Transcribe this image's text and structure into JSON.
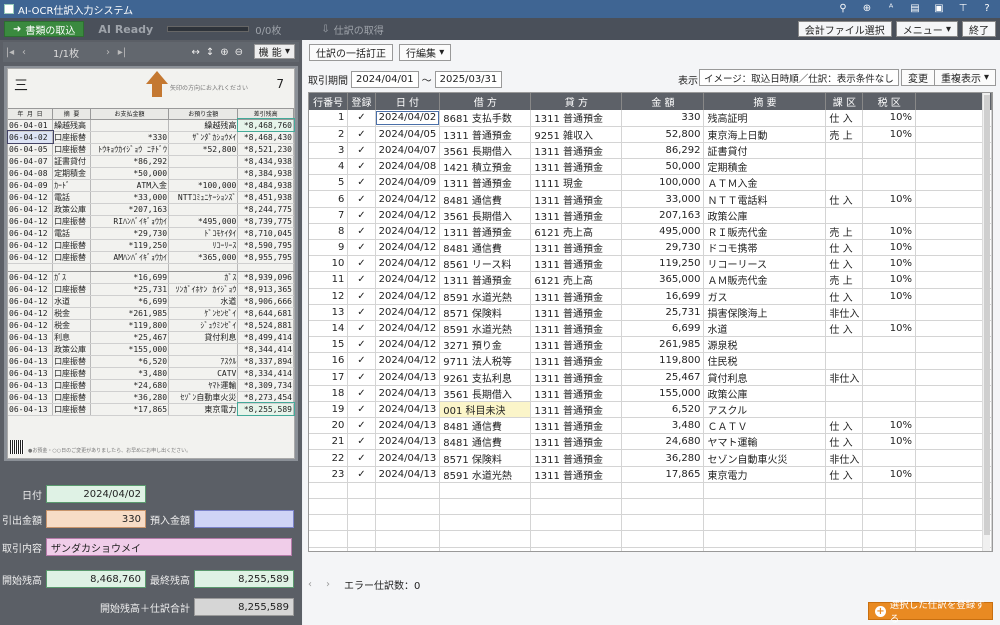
{
  "app": {
    "title": "AI-OCR仕訳入力システム"
  },
  "toolbar": {
    "capture_label": "書類の取込",
    "ai_status": "AI Ready",
    "ai_progress": 0.0,
    "count": "0/0枚",
    "fetch_label": "仕訳の取得",
    "account_file_label": "会計ファイル選択",
    "menu_label": "メニュー",
    "exit_label": "終了"
  },
  "viewer": {
    "page": "1/1枚",
    "function_label": "機 能",
    "doc_mark": "三",
    "doc_hint": "矢印の方向にお入れください",
    "doc_page": "7",
    "headers": [
      "年 月 日",
      "摘 要",
      "お支払金額",
      "お預り金額",
      "差引残高"
    ],
    "rows": [
      [
        "06-04-01",
        "繰越残高",
        "",
        "繰越残高",
        "*8,468,760"
      ],
      [
        "06-04-02",
        "口座振替",
        "*330",
        "ｻﾞﾝﾀﾞｶｼｮｳﾒｲ",
        "*8,468,430"
      ],
      [
        "06-04-05",
        "口座振替",
        "ﾄｳｷｮｳｶｲｼﾞｮｳ ﾆﾁﾄﾞｳ",
        "*52,800",
        "*8,521,230"
      ],
      [
        "06-04-07",
        "証書貸付",
        "*86,292",
        "",
        "*8,434,938"
      ],
      [
        "06-04-08",
        "定期積金",
        "*50,000",
        "",
        "*8,384,938"
      ],
      [
        "06-04-09",
        "ｶｰﾄﾞ",
        "ATM入金",
        "*100,000",
        "*8,484,938"
      ],
      [
        "06-04-12",
        "電話",
        "*33,000",
        "NTTｺﾐｭﾆｹｰｼｮﾝｽﾞ",
        "*8,451,938"
      ],
      [
        "06-04-12",
        "政策公庫",
        "*207,163",
        "",
        "*8,244,775"
      ],
      [
        "06-04-12",
        "口座振替",
        "RIﾊﾝﾊﾞｲｷﾞｮｳｶｲ",
        "*495,000",
        "*8,739,775"
      ],
      [
        "06-04-12",
        "電話",
        "*29,730",
        "ﾄﾞｺﾓｹｲﾀｲ",
        "*8,710,045"
      ],
      [
        "06-04-12",
        "口座振替",
        "*119,250",
        "ﾘｺｰﾘｰｽ",
        "*8,590,795"
      ],
      [
        "06-04-12",
        "口座振替",
        "AMﾊﾝﾊﾞｲｷﾞｮｳｶｲ",
        "*365,000",
        "*8,955,795"
      ],
      [
        "06-04-12",
        "ｶﾞｽ",
        "*16,699",
        "ｶﾞｽ",
        "*8,939,096"
      ],
      [
        "06-04-12",
        "口座振替",
        "*25,731",
        "ｿﾝｶﾞｲﾎｹﾝ ｶｲｼﾞｮｳ",
        "*8,913,365"
      ],
      [
        "06-04-12",
        "水道",
        "*6,699",
        "水道",
        "*8,906,666"
      ],
      [
        "06-04-12",
        "税金",
        "*261,985",
        "ｹﾞﾝｾﾝｾﾞｲ",
        "*8,644,681"
      ],
      [
        "06-04-12",
        "税金",
        "*119,800",
        "ｼﾞｭｳﾐﾝｾﾞｲ",
        "*8,524,881"
      ],
      [
        "06-04-13",
        "利息",
        "*25,467",
        "貸付利息",
        "*8,499,414"
      ],
      [
        "06-04-13",
        "政策公庫",
        "*155,000",
        "",
        "*8,344,414"
      ],
      [
        "06-04-13",
        "口座振替",
        "*6,520",
        "ｱｽｸﾙ",
        "*8,337,894"
      ],
      [
        "06-04-13",
        "口座振替",
        "*3,480",
        "CATV",
        "*8,334,414"
      ],
      [
        "06-04-13",
        "口座振替",
        "*24,680",
        "ﾔﾏﾄ運輸",
        "*8,309,734"
      ],
      [
        "06-04-13",
        "口座振替",
        "*36,280",
        "ｾｿﾞﾝ自動車火災",
        "*8,273,454"
      ],
      [
        "06-04-13",
        "口座振替",
        "*17,865",
        "東京電力",
        "*8,255,589"
      ]
    ],
    "footnote": "●お預金・○○日のご変更がありましたら、お早めにお申し出ください。"
  },
  "fields": {
    "date_label": "日付",
    "date_value": "2024/04/02",
    "withdrawal_label": "引出金額",
    "withdrawal_value": "330",
    "deposit_label": "預入金額",
    "deposit_value": "",
    "content_label": "取引内容",
    "content_value": "ザンダカショウメイ",
    "start_balance_label": "開始残高",
    "start_balance_value": "8,468,760",
    "end_balance_label": "最終残高",
    "end_balance_value": "8,255,589",
    "sum_label": "開始残高＋仕訳合計",
    "sum_value": "8,255,589"
  },
  "journal": {
    "bulk_fix_label": "仕訳の一括訂正",
    "row_edit_label": "行編集",
    "period_label": "取引期間",
    "date_from": "2024/04/01",
    "date_to": "2025/03/31",
    "display_label": "表示",
    "display_value": "イメージ：取込日時順／仕訳：表示条件なし",
    "change_label": "変更",
    "dup_label": "重複表示",
    "columns": [
      "行番号",
      "登録",
      "日 付",
      "借 方",
      "貸 方",
      "金 額",
      "摘 要",
      "課 区",
      "税 区"
    ],
    "rows": [
      [
        "1",
        "✓",
        "2024/04/02",
        "8681 支払手数",
        "1311 普通預金",
        "330",
        "残高証明",
        "仕 入",
        "10%"
      ],
      [
        "2",
        "✓",
        "2024/04/05",
        "1311 普通預金",
        "9251 雑収入",
        "52,800",
        "東京海上日動",
        "売 上",
        "10%"
      ],
      [
        "3",
        "✓",
        "2024/04/07",
        "3561 長期借入",
        "1311 普通預金",
        "86,292",
        "証書貸付",
        "",
        ""
      ],
      [
        "4",
        "✓",
        "2024/04/08",
        "1421 積立預金",
        "1311 普通預金",
        "50,000",
        "定期積金",
        "",
        ""
      ],
      [
        "5",
        "✓",
        "2024/04/09",
        "1311 普通預金",
        "1111 現金",
        "100,000",
        "ＡＴＭ入金",
        "",
        ""
      ],
      [
        "6",
        "✓",
        "2024/04/12",
        "8481 通信費",
        "1311 普通預金",
        "33,000",
        "ＮＴＴ電話料",
        "仕 入",
        "10%"
      ],
      [
        "7",
        "✓",
        "2024/04/12",
        "3561 長期借入",
        "1311 普通預金",
        "207,163",
        "政策公庫",
        "",
        ""
      ],
      [
        "8",
        "✓",
        "2024/04/12",
        "1311 普通預金",
        "6121 売上高",
        "495,000",
        "ＲＩ販売代金",
        "売 上",
        "10%"
      ],
      [
        "9",
        "✓",
        "2024/04/12",
        "8481 通信費",
        "1311 普通預金",
        "29,730",
        "ドコモ携帯",
        "仕 入",
        "10%"
      ],
      [
        "10",
        "✓",
        "2024/04/12",
        "8561 リース料",
        "1311 普通預金",
        "119,250",
        "リコーリース",
        "仕 入",
        "10%"
      ],
      [
        "11",
        "✓",
        "2024/04/12",
        "1311 普通預金",
        "6121 売上高",
        "365,000",
        "ＡＭ販売代金",
        "売 上",
        "10%"
      ],
      [
        "12",
        "✓",
        "2024/04/12",
        "8591 水道光熱",
        "1311 普通預金",
        "16,699",
        "ガス",
        "仕 入",
        "10%"
      ],
      [
        "13",
        "✓",
        "2024/04/12",
        "8571 保険料",
        "1311 普通預金",
        "25,731",
        "損害保険海上",
        "非仕入",
        ""
      ],
      [
        "14",
        "✓",
        "2024/04/12",
        "8591 水道光熱",
        "1311 普通預金",
        "6,699",
        "水道",
        "仕 入",
        "10%"
      ],
      [
        "15",
        "✓",
        "2024/04/12",
        "3271 預り金",
        "1311 普通預金",
        "261,985",
        "源泉税",
        "",
        ""
      ],
      [
        "16",
        "✓",
        "2024/04/12",
        "9711 法人税等",
        "1311 普通預金",
        "119,800",
        "住民税",
        "",
        ""
      ],
      [
        "17",
        "✓",
        "2024/04/13",
        "9261 支払利息",
        "1311 普通預金",
        "25,467",
        "貸付利息",
        "非仕入",
        ""
      ],
      [
        "18",
        "✓",
        "2024/04/13",
        "3561 長期借入",
        "1311 普通預金",
        "155,000",
        "政策公庫",
        "",
        ""
      ],
      [
        "19",
        "✓",
        "2024/04/13",
        "001 科目未決",
        "1311 普通預金",
        "6,520",
        "アスクル",
        "",
        ""
      ],
      [
        "20",
        "✓",
        "2024/04/13",
        "8481 通信費",
        "1311 普通預金",
        "3,480",
        "ＣＡＴＶ",
        "仕 入",
        "10%"
      ],
      [
        "21",
        "✓",
        "2024/04/13",
        "8481 通信費",
        "1311 普通預金",
        "24,680",
        "ヤマト運輸",
        "仕 入",
        "10%"
      ],
      [
        "22",
        "✓",
        "2024/04/13",
        "8571 保険料",
        "1311 普通預金",
        "36,280",
        "セゾン自動車火災",
        "非仕入",
        ""
      ],
      [
        "23",
        "✓",
        "2024/04/13",
        "8591 水道光熱",
        "1311 普通預金",
        "17,865",
        "東京電力",
        "仕 入",
        "10%"
      ]
    ],
    "error_count": "エラー仕訳数：0",
    "register_label": "選択した仕訳を登録する"
  }
}
